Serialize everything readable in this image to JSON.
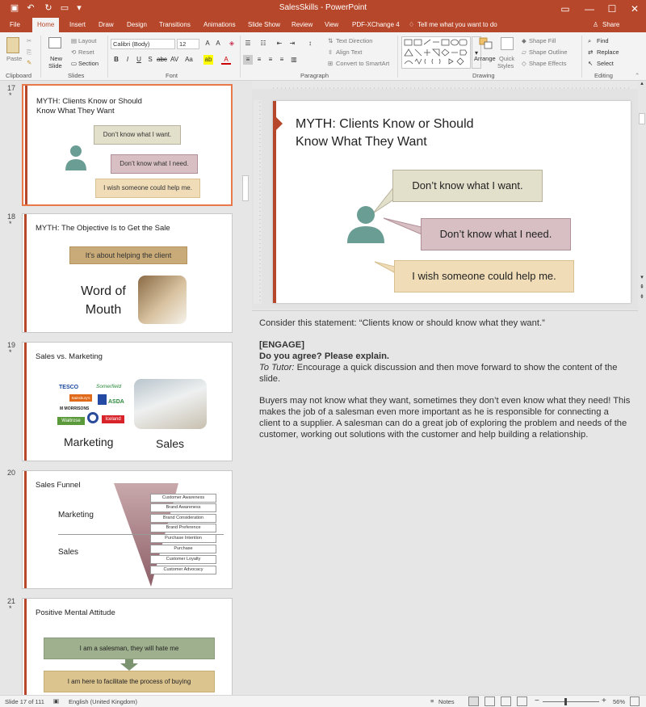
{
  "app": {
    "title": "SalesSkills  -  PowerPoint",
    "colors": {
      "accent": "#b7472a",
      "ribbon": "#f3f3f3"
    }
  },
  "quick_access": [
    "save-icon",
    "undo-icon",
    "redo-icon",
    "present-icon",
    "customize-icon"
  ],
  "tabs": [
    "File",
    "Home",
    "Insert",
    "Draw",
    "Design",
    "Transitions",
    "Animations",
    "Slide Show",
    "Review",
    "View",
    "PDF-XChange 4"
  ],
  "tell_me": "Tell me what you want to do",
  "share": "Share",
  "ribbon": {
    "clipboard": {
      "paste": "Paste",
      "label": "Clipboard"
    },
    "slides": {
      "new_slide": "New",
      "new_slide2": "Slide",
      "layout": "Layout",
      "reset": "Reset",
      "section": "Section",
      "label": "Slides"
    },
    "font": {
      "name": "Calibri (Body)",
      "size": "12",
      "label": "Font"
    },
    "paragraph": {
      "text_direction": "Text Direction",
      "align_text": "Align Text",
      "smartart": "Convert to SmartArt",
      "label": "Paragraph"
    },
    "drawing": {
      "arrange": "Arrange",
      "quick_styles": "Quick",
      "quick_styles2": "Styles",
      "shape_fill": "Shape Fill",
      "shape_outline": "Shape Outline",
      "shape_effects": "Shape Effects",
      "label": "Drawing"
    },
    "editing": {
      "find": "Find",
      "replace": "Replace",
      "select": "Select",
      "label": "Editing"
    }
  },
  "thumbnails": [
    {
      "num": "17",
      "title_l1": "MYTH: Clients Know or Should",
      "title_l2": "Know What They Want",
      "b1": "Don’t know what I want.",
      "b2": "Don’t know what I need.",
      "b3": "I  wish someone could help me."
    },
    {
      "num": "18",
      "title": "MYTH: The Objective Is to Get the Sale",
      "banner": "It’s about helping the client",
      "wom_l1": "Word of",
      "wom_l2": "Mouth"
    },
    {
      "num": "19",
      "title": "Sales vs. Marketing",
      "marketing": "Marketing",
      "sales": "Sales",
      "brands": [
        "TESCO",
        "Somerfield",
        "Sainsbury's",
        "M MORRISONS",
        "ASDA",
        "Waitrose",
        "Iceland"
      ]
    },
    {
      "num": "20",
      "title": "Sales Funnel",
      "marketing": "Marketing",
      "sales": "Sales",
      "stages": [
        "Customer Awareness",
        "Brand Awareness",
        "Brand Consideration",
        "Brand Preference",
        "Purchase Intention",
        "Purchase",
        "Customer Loyalty",
        "Customer Advocacy"
      ]
    },
    {
      "num": "21",
      "title": "Positive Mental Attitude",
      "top": "I am a salesman, they will hate me",
      "bottom": "I am here to facilitate the process of buying"
    }
  ],
  "slide": {
    "title_l1": "MYTH: Clients Know or Should",
    "title_l2": "Know What They Want",
    "b1": "Don’t know what I want.",
    "b2": "Don’t know what I need.",
    "b3": "I  wish someone could help me."
  },
  "notes": {
    "p1": "Consider this statement: “Clients know or should know what they want.”",
    "engage": "[ENGAGE]",
    "question": "Do you agree? Please explain.",
    "tutor_label": "To Tutor:",
    "tutor_text": " Encourage a quick discussion and then move forward to show the content of the slide.",
    "p2": "Buyers may not know what they want, sometimes they don’t even know what they need! This makes the job of a salesman even more important as he is responsible for connecting a client to a supplier. A salesman can do a great job of exploring the problem and needs of the customer, working out solutions with the customer and help building a relationship."
  },
  "status": {
    "slide": "Slide 17 of 111",
    "lang": "English (United Kingdom)",
    "notes": "Notes",
    "zoom": "56%"
  }
}
